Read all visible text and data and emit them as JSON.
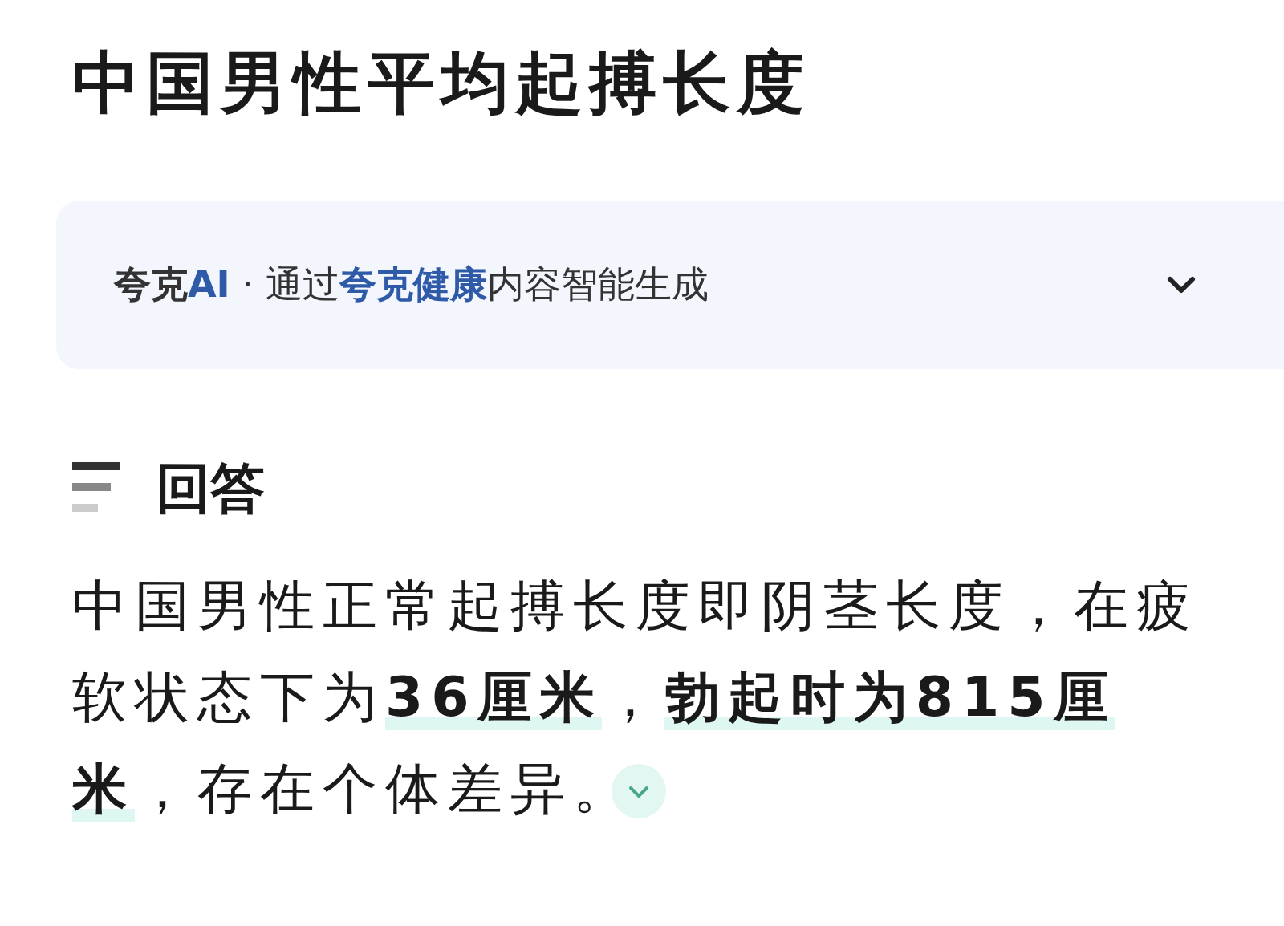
{
  "title": "中国男性平均起搏长度",
  "source": {
    "segments": [
      {
        "text": "夸克",
        "kind": "brand"
      },
      {
        "text": "AI",
        "kind": "accent"
      },
      {
        "text": " · 通过",
        "kind": "plain"
      },
      {
        "text": "夸克健康",
        "kind": "accent"
      },
      {
        "text": "内容智能生成",
        "kind": "plain"
      }
    ],
    "expanded": false
  },
  "answer": {
    "heading": "回答",
    "text": "中国男性正常起搏长度即阴茎长度，在疲软状态下为**36厘米**，**勃起时为815厘米**，存在个体差异。",
    "expanded": false
  }
}
